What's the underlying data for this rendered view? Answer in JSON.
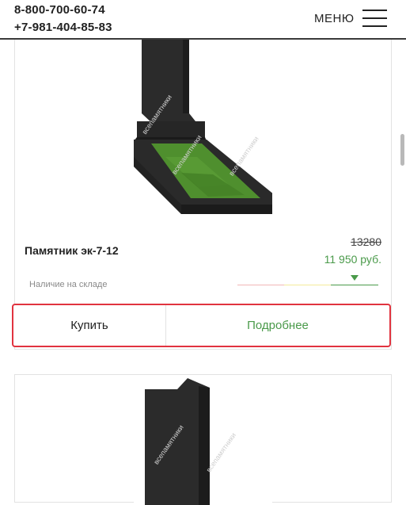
{
  "header": {
    "phone_primary": "8-800-700-60-74",
    "phone_secondary": "+7-981-404-85-83",
    "menu_label": "МЕНЮ"
  },
  "product": {
    "title": "Памятник эк-7-12",
    "old_price": "13280",
    "new_price": "11 950 руб.",
    "stock_text": "Наличие на складе",
    "stock_level": "high",
    "buy_label": "Купить",
    "details_label": "Подробнее"
  },
  "watermark": "всепамятники",
  "colors": {
    "accent_green": "#4a9a4a",
    "highlight_red": "#e1333f",
    "granite": "#2a2a2a",
    "grass": "#4f8f2e"
  }
}
